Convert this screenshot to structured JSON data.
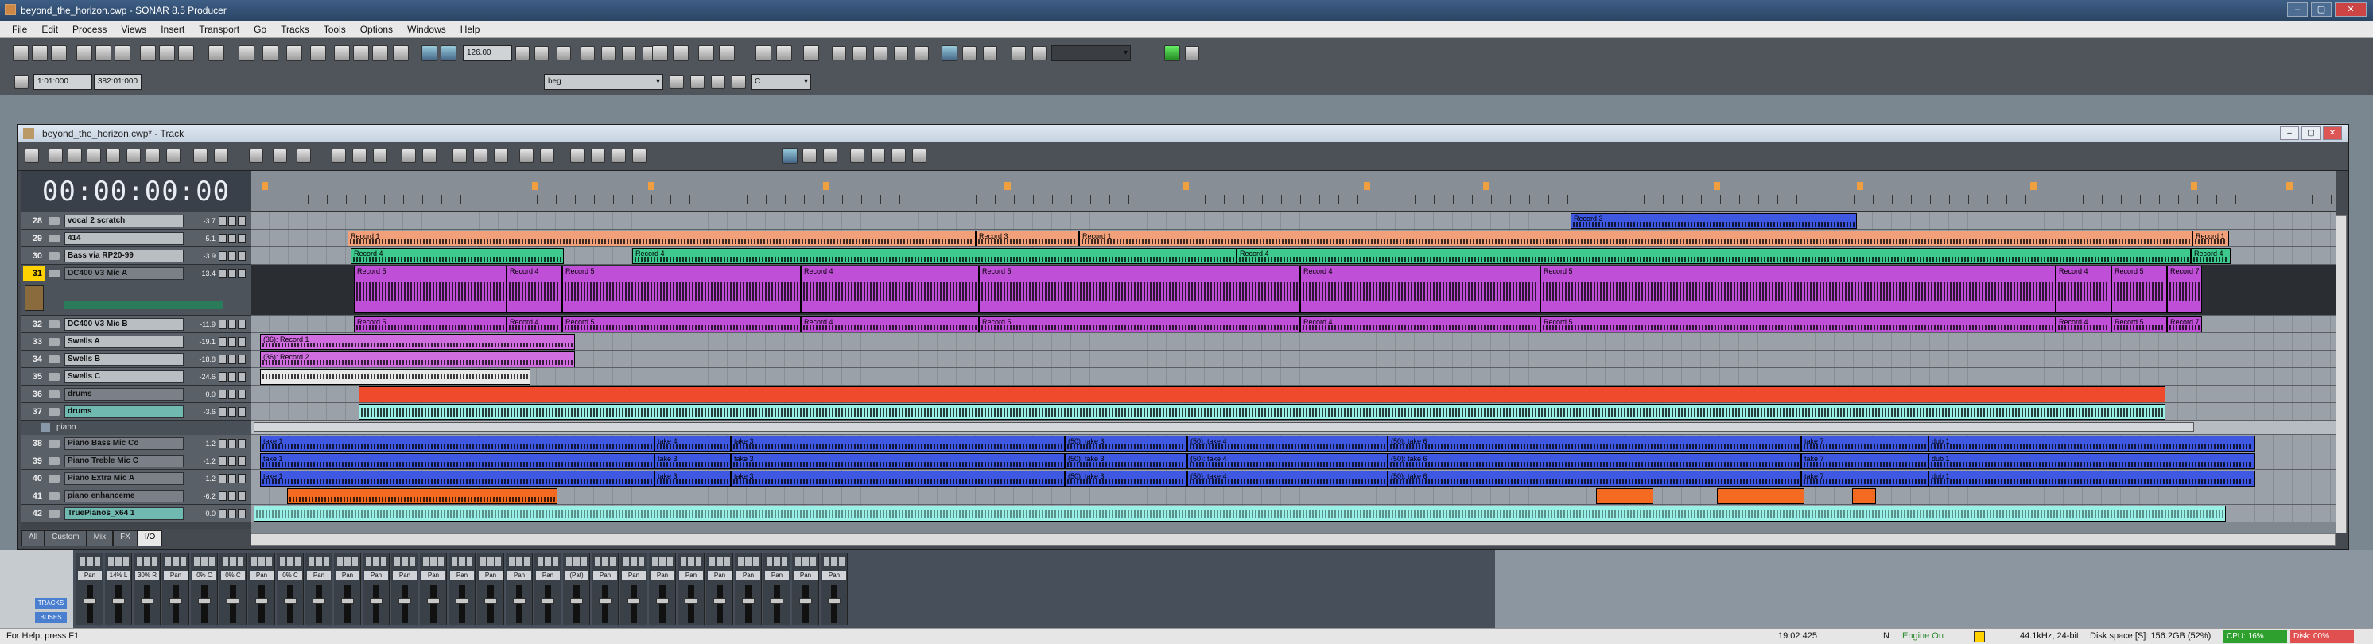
{
  "app": {
    "title": "beyond_the_horizon.cwp - SONAR 8.5 Producer",
    "window_buttons": [
      "–",
      "▢",
      "✕"
    ]
  },
  "menu": [
    "File",
    "Edit",
    "Process",
    "Views",
    "Insert",
    "Transport",
    "Go",
    "Tracks",
    "Tools",
    "Options",
    "Windows",
    "Help"
  ],
  "toolbar": {
    "tempo": "126.00",
    "time_now": "1:01:000",
    "time_end": "382:01:000",
    "marker_dropdown": "beg",
    "key_dropdown": "C"
  },
  "track_window": {
    "title": "beyond_the_horizon.cwp* - Track",
    "clock": "00:00:00:00"
  },
  "tracks": [
    {
      "num": "28",
      "name": "vocal 2 scratch",
      "vol": "-3.7"
    },
    {
      "num": "29",
      "name": "414",
      "vol": "-5.1"
    },
    {
      "num": "30",
      "name": "Bass via RP20-99",
      "vol": "-3.9"
    },
    {
      "num": "31",
      "name": "DC400 V3 Mic A",
      "vol": "-13.4"
    },
    {
      "num": "32",
      "name": "DC400 V3 Mic B",
      "vol": "-11.9"
    },
    {
      "num": "33",
      "name": "Swells A",
      "vol": "-19.1"
    },
    {
      "num": "34",
      "name": "Swells B",
      "vol": "-18.8"
    },
    {
      "num": "35",
      "name": "Swells C",
      "vol": "-24.6"
    },
    {
      "num": "36",
      "name": "drums",
      "vol": "0.0"
    },
    {
      "num": "37",
      "name": "drums",
      "vol": "-3.6"
    },
    {
      "num": "38",
      "name": "Piano Bass Mic Co",
      "vol": "-1.2"
    },
    {
      "num": "39",
      "name": "Piano Treble Mic C",
      "vol": "-1.2"
    },
    {
      "num": "40",
      "name": "Piano Extra Mic A",
      "vol": "-1.2"
    },
    {
      "num": "41",
      "name": "piano enhanceme",
      "vol": "-6.2"
    },
    {
      "num": "42",
      "name": "TruePianos_x64 1",
      "vol": "0.0"
    }
  ],
  "folder_name": "piano",
  "tabs": [
    "All",
    "Custom",
    "Mix",
    "FX",
    "I/O"
  ],
  "clips": {
    "r28": [
      {
        "label": "Record 3"
      }
    ],
    "r29": [
      {
        "label": "Record 1"
      },
      {
        "label": "Record 3"
      },
      {
        "label": "Record 1"
      },
      {
        "label": "Record 1"
      }
    ],
    "r30": [
      {
        "label": "Record 4"
      },
      {
        "label": "Record 4"
      },
      {
        "label": "Record 4"
      },
      {
        "label": "Record 4"
      }
    ],
    "r31": [
      {
        "label": "Record 5"
      },
      {
        "label": "Record 4"
      },
      {
        "label": "Record 5"
      },
      {
        "label": "Record 4"
      },
      {
        "label": "Record 5"
      },
      {
        "label": "Record 4"
      },
      {
        "label": "Record 5"
      },
      {
        "label": "Record 4"
      },
      {
        "label": "Record 5"
      },
      {
        "label": "Record 7"
      }
    ],
    "r32": [
      {
        "label": "Record 5"
      },
      {
        "label": "Record 4"
      },
      {
        "label": "Record 5"
      },
      {
        "label": "Record 4"
      },
      {
        "label": "Record 5"
      },
      {
        "label": "Record 4"
      },
      {
        "label": "Record 5"
      },
      {
        "label": "Record 4"
      },
      {
        "label": "Record 5"
      },
      {
        "label": "Record 7"
      }
    ],
    "r33": [
      {
        "label": "(36): Record 1"
      }
    ],
    "r34": [
      {
        "label": "(36): Record 2"
      }
    ],
    "r38": [
      {
        "label": "take 1"
      },
      {
        "label": "take 4"
      },
      {
        "label": "take 3"
      },
      {
        "label": "(50): take 3"
      },
      {
        "label": "(50): take 4"
      },
      {
        "label": "(50): take 6"
      },
      {
        "label": "take 7"
      },
      {
        "label": "dub 1"
      }
    ],
    "r39": [
      {
        "label": "take 1"
      },
      {
        "label": "take 3"
      },
      {
        "label": "take 3"
      },
      {
        "label": "(50): take 3"
      },
      {
        "label": "(50): take 4"
      },
      {
        "label": "(50): take 6"
      },
      {
        "label": "take 7"
      },
      {
        "label": "dub 1"
      }
    ],
    "r40": [
      {
        "label": "take 1"
      },
      {
        "label": "take 3"
      },
      {
        "label": "take 3"
      },
      {
        "label": "(50): take 3"
      },
      {
        "label": "(50): take 4"
      },
      {
        "label": "(50): take 6"
      },
      {
        "label": "take 7"
      },
      {
        "label": "dub 1"
      }
    ]
  },
  "console": {
    "strip_labels": [
      "Pan",
      "14% L",
      "30% R",
      "Pan",
      "0% C",
      "0% C",
      "Pan",
      "0% C",
      "Pan",
      "Pan",
      "Pan",
      "Pan",
      "Pan",
      "Pan",
      "Pan",
      "Pan",
      "Pan",
      "(Pat)",
      "Pan",
      "Pan",
      "Pan",
      "Pan",
      "Pan",
      "Pan",
      "Pan",
      "Pan",
      "Pan"
    ],
    "side_labels": [
      "TRACKS",
      "BUSES"
    ]
  },
  "status": {
    "help": "For Help, press F1",
    "time": "19:02:425",
    "mode": "N",
    "engine": "Engine On",
    "format": "44.1kHz, 24-bit",
    "disk_space": "Disk space [S]: 156.2GB (52%)",
    "cpu": "CPU: 16%",
    "disk": "Disk: 00%"
  },
  "colors": {
    "orange_clip": "#f2a07a",
    "green_clip": "#3ec98e",
    "magenta_clip": "#c04fd8",
    "blue_clip": "#3e58e2",
    "red_clip": "#f04a2c",
    "teal_clip": "#98f0e6",
    "selected_track": "#ffd200"
  }
}
